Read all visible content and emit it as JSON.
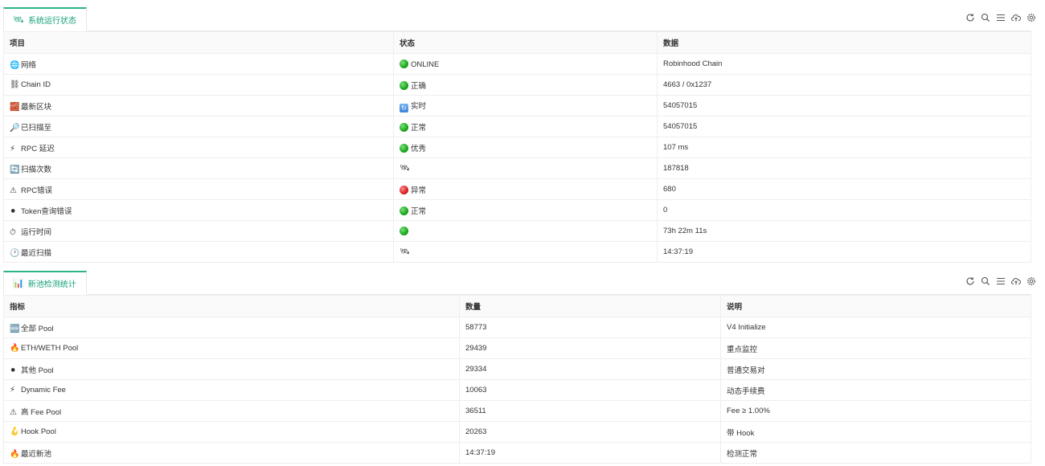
{
  "status_panel": {
    "tab_icon": "satellite-icon",
    "tab_label": "系统运行状态",
    "columns": [
      "项目",
      "状态",
      "数据"
    ],
    "rows": [
      {
        "icon": "🌐",
        "icon_name": "globe-icon",
        "item": "网络",
        "status_icon": "green",
        "status": "ONLINE",
        "data": "Robinhood Chain"
      },
      {
        "icon": "⛓",
        "icon_name": "chain-icon",
        "item": "Chain ID",
        "status_icon": "green",
        "status": "正确",
        "data": "4663 / 0x1237"
      },
      {
        "icon": "🧱",
        "icon_name": "brick-icon",
        "item": "最新区块",
        "status_icon": "refresh",
        "status": "实时",
        "data": "54057015"
      },
      {
        "icon": "🔎",
        "icon_name": "magnifier-icon",
        "item": "已扫描至",
        "status_icon": "green",
        "status": "正常",
        "data": "54057015"
      },
      {
        "icon": "⚡",
        "icon_name": "lightning-icon",
        "item": "RPC 延迟",
        "status_icon": "green",
        "status": "优秀",
        "data": "107 ms"
      },
      {
        "icon": "🔄",
        "icon_name": "refresh-icon",
        "item": "扫描次数",
        "status_icon": "satellite",
        "status": "",
        "data": "187818"
      },
      {
        "icon": "⚠",
        "icon_name": "warning-icon",
        "item": "RPC错误",
        "status_icon": "red",
        "status": "异常",
        "data": "680"
      },
      {
        "icon": "⚫",
        "icon_name": "orb-icon",
        "item": "Token查询错误",
        "status_icon": "green",
        "status": "正常",
        "data": "0"
      },
      {
        "icon": "⏱",
        "icon_name": "stopwatch-icon",
        "item": "运行时间",
        "status_icon": "green",
        "status": "",
        "data": "73h 22m 11s"
      },
      {
        "icon": "🕐",
        "icon_name": "clock-icon",
        "item": "最近扫描",
        "status_icon": "satellite",
        "status": "",
        "data": "14:37:19"
      }
    ]
  },
  "pools_panel": {
    "tab_icon": "bar-chart-icon",
    "tab_label": "新池检测统计",
    "columns": [
      "指标",
      "数量",
      "说明"
    ],
    "rows": [
      {
        "icon": "🆕",
        "icon_name": "new-badge-icon",
        "item": "全部 Pool",
        "count": "58773",
        "desc": "V4 Initialize"
      },
      {
        "icon": "🔥",
        "icon_name": "fire-icon",
        "item": "ETH/WETH Pool",
        "count": "29439",
        "desc": "重点监控"
      },
      {
        "icon": "⚫",
        "icon_name": "orb-icon",
        "item": "其他 Pool",
        "count": "29334",
        "desc": "普通交易对"
      },
      {
        "icon": "⚡",
        "icon_name": "lightning-icon",
        "item": "Dynamic Fee",
        "count": "10063",
        "desc": "动态手续费"
      },
      {
        "icon": "⚠",
        "icon_name": "warning-icon",
        "item": "高 Fee Pool",
        "count": "36511",
        "desc": "Fee ≥ 1.00%"
      },
      {
        "icon": "🪝",
        "icon_name": "hook-icon",
        "item": "Hook Pool",
        "count": "20263",
        "desc": "带 Hook"
      },
      {
        "icon": "🔥",
        "icon_name": "fire-icon",
        "item": "最近新池",
        "count": "14:37:19",
        "desc": "检测正常"
      }
    ]
  },
  "toolbar_icons": [
    "refresh-icon",
    "search-icon",
    "list-icon",
    "cloud-upload-icon",
    "settings-icon"
  ],
  "colors": {
    "accent": "#2bb48a",
    "tab_text": "#16a179",
    "border": "#eeeeee",
    "header_bg": "#fafafa"
  }
}
